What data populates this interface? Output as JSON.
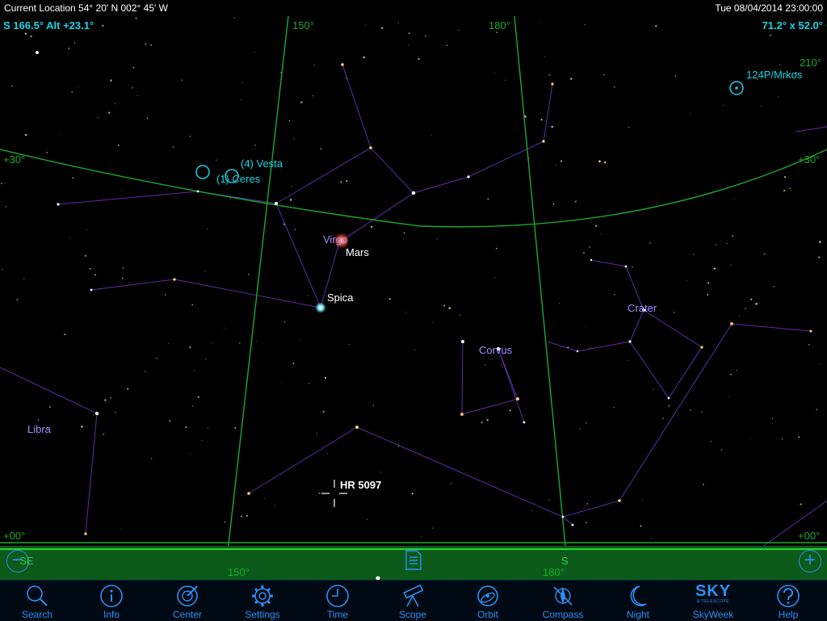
{
  "status_bar": {
    "location": "Current Location  54° 20' N 002° 45' W",
    "datetime": "Tue 08/04/2014  23:00:00"
  },
  "hud": {
    "pointing": "S 166.5° Alt +23.1°",
    "field_of_view": "71.2° x 52.0°"
  },
  "grid_labels": {
    "az_150_top": "150°",
    "az_180_top": "180°",
    "az_210": "210°",
    "alt_30_left": "+30°",
    "alt_30_right": "+30°",
    "alt_0_left": "+00°",
    "alt_0_right": "+00°",
    "az_150_bottom": "150°",
    "az_180_bottom": "180°"
  },
  "horizon_labels": {
    "southeast": "SE",
    "south": "S"
  },
  "sky_labels": {
    "vesta": "(4) Vesta",
    "ceres": "(1) Ceres",
    "comet": "124P/Mrkos",
    "virgo": "Virgo",
    "mars": "Mars",
    "spica": "Spica",
    "crater": "Crater",
    "corvus": "Corvus",
    "libra": "Libra",
    "selected_star": "HR 5097"
  },
  "colors": {
    "accent": "#2e8ff2",
    "hud_cyan": "#19d6e6",
    "grid_green": "#1fa82a",
    "constellation_line": "#5a2ea8",
    "constellation_name": "#a08cff",
    "ground": "#0b5a1a"
  },
  "toolbar": {
    "search": "Search",
    "info": "Info",
    "center": "Center",
    "settings": "Settings",
    "time": "Time",
    "scope": "Scope",
    "orbit": "Orbit",
    "compass": "Compass",
    "night": "Night",
    "skyweek": "SkyWeek",
    "help": "Help",
    "skyweek_logo": "SKY",
    "skyweek_logo_sub": "& TELESCOPE"
  },
  "icons": {
    "search": "magnifier-icon",
    "info": "info-icon",
    "center": "crosshair-icon",
    "settings": "gear-icon",
    "time": "clock-icon",
    "scope": "telescope-icon",
    "orbit": "orbit-icon",
    "compass": "compass-icon",
    "night": "moon-icon",
    "help": "help-icon",
    "zoom_out": "minus-icon",
    "zoom_in": "plus-icon",
    "notes": "document-icon"
  },
  "zoom": {
    "out": "−",
    "in": "+"
  }
}
